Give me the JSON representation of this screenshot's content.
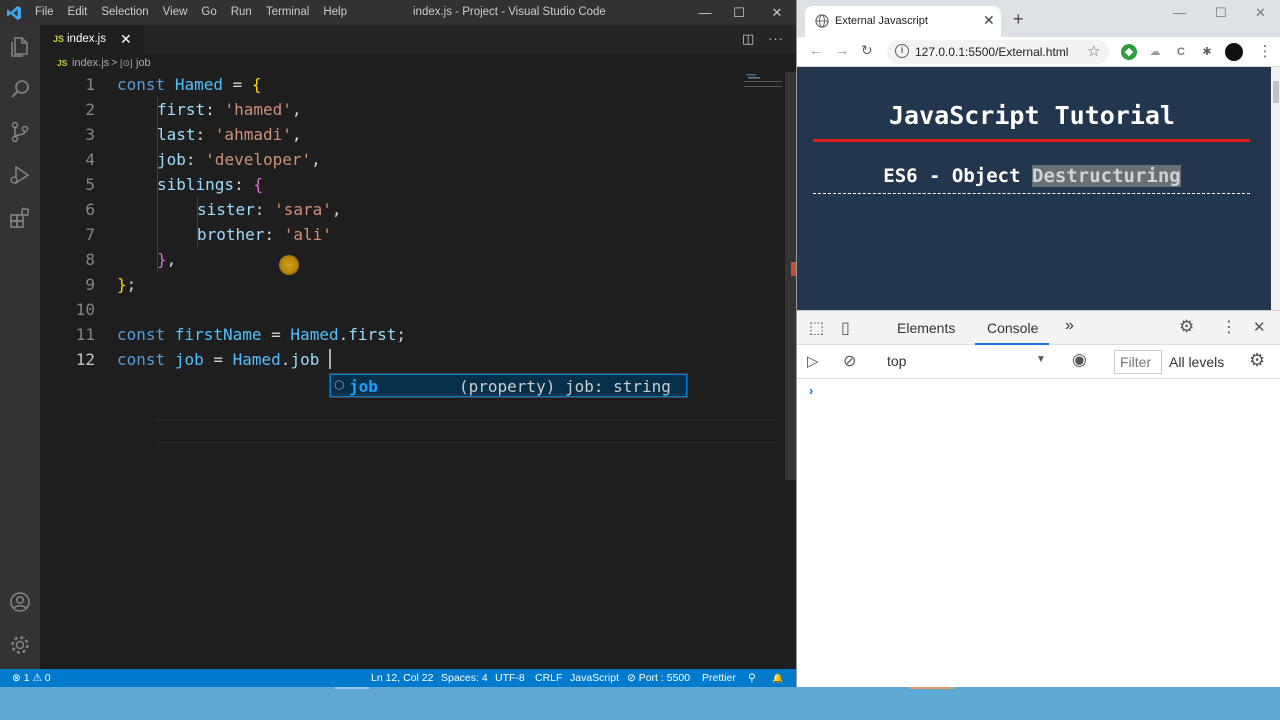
{
  "vscode": {
    "menu": [
      "File",
      "Edit",
      "Selection",
      "View",
      "Go",
      "Run",
      "Terminal",
      "Help"
    ],
    "window_title": "index.js - Project - Visual Studio Code",
    "window_controls": {
      "minimize": "—",
      "maximize": "☐",
      "close": "✕"
    },
    "tab": {
      "badge": "JS",
      "name": "index.js",
      "close": "✕"
    },
    "breadcrumb": {
      "badge": "JS",
      "file": "index.js",
      "sep": ">",
      "symbol_icon": "[⊙]",
      "symbol": "job"
    },
    "line_numbers": [
      "1",
      "2",
      "3",
      "4",
      "5",
      "6",
      "7",
      "8",
      "9",
      "10",
      "11",
      "12"
    ],
    "code": {
      "l1": {
        "kw": "const",
        "name": "Hamed",
        "eq": " = ",
        "brace": "{"
      },
      "l2": {
        "prop": "first",
        "colon": ": ",
        "str": "'hamed'",
        "comma": ","
      },
      "l3": {
        "prop": "last",
        "colon": ": ",
        "str": "'ahmadi'",
        "comma": ","
      },
      "l4": {
        "prop": "job",
        "colon": ": ",
        "str": "'developer'",
        "comma": ","
      },
      "l5": {
        "prop": "siblings",
        "colon": ": ",
        "brace": "{"
      },
      "l6": {
        "prop": "sister",
        "colon": ": ",
        "str": "'sara'",
        "comma": ","
      },
      "l7": {
        "prop": "brother",
        "colon": ": ",
        "str": "'ali'"
      },
      "l8": {
        "brace": "}",
        "comma": ","
      },
      "l9": {
        "brace": "}",
        "semi": ";"
      },
      "l11": {
        "kw": "const",
        "name": "firstName",
        "eq": " = ",
        "obj": "Hamed",
        "dot": ".",
        "prop": "first",
        "semi": ";"
      },
      "l12": {
        "kw": "const",
        "name": "job",
        "eq": " = ",
        "obj": "Hamed",
        "dot": ".",
        "prop": "job"
      }
    },
    "suggestion": {
      "icon": "⬡",
      "label": "job",
      "detail": "(property) job: string"
    },
    "status": {
      "problems": "⊗ 1 ⚠ 0",
      "position": "Ln 12, Col 22",
      "spaces": "Spaces: 4",
      "encoding": "UTF-8",
      "eol": "CRLF",
      "language": "JavaScript",
      "port": "⊘ Port : 5500",
      "formatter": "Prettier",
      "feedback": "⚲",
      "bell": "🔔"
    }
  },
  "browser": {
    "tab_title": "External Javascript",
    "tab_close": "✕",
    "new_tab": "+",
    "window_controls": {
      "minimize": "—",
      "maximize": "☐",
      "close": "✕"
    },
    "nav": {
      "back": "←",
      "forward": "→",
      "reload": "↻"
    },
    "url": "127.0.0.1:5500/External.html",
    "star": "☆",
    "page": {
      "title": "JavaScript Tutorial",
      "subtitle_plain": "ES6 - Object ",
      "subtitle_highlight": "Destructuring"
    },
    "devtools": {
      "tabs": {
        "elements": "Elements",
        "console": "Console",
        "more": "»"
      },
      "context": "top",
      "filter_placeholder": "Filter",
      "levels": "All levels",
      "prompt": "›",
      "close": "✕",
      "kebab": "⋮"
    }
  },
  "colors": {
    "editor_bg": "#1e1e1e",
    "status_bar": "#007acc",
    "page_bg": "#22364e",
    "page_redline": "#e11d1d"
  }
}
